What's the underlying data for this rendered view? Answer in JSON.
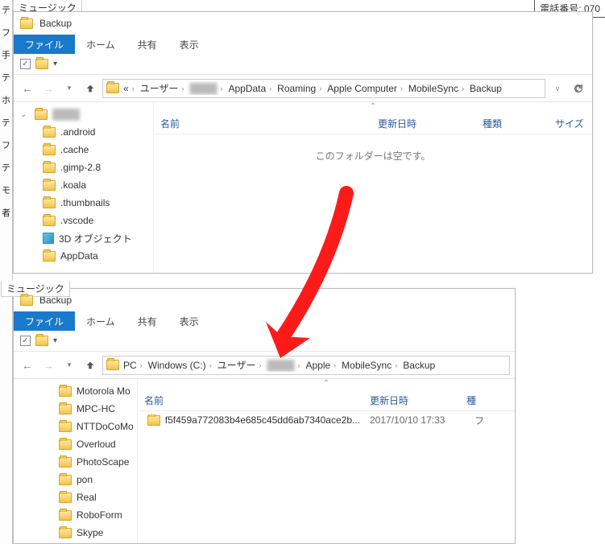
{
  "background": {
    "left_strip": [
      "テ",
      "フ",
      "手",
      "テ",
      "ホ",
      "テ",
      "フ",
      "テ",
      "モ",
      "者"
    ],
    "top_label": "ミュージック",
    "phone": "電話番号: 070"
  },
  "explorer1": {
    "title": "Backup",
    "tabs": {
      "file": "ファイル",
      "home": "ホーム",
      "share": "共有",
      "view": "表示"
    },
    "breadcrumb": [
      {
        "label": "«",
        "icon": false
      },
      {
        "label": "ユーザー"
      },
      {
        "label": "████",
        "blur": true
      },
      {
        "label": "AppData"
      },
      {
        "label": "Roaming"
      },
      {
        "label": "Apple Computer"
      },
      {
        "label": "MobileSync"
      },
      {
        "label": "Backup"
      }
    ],
    "tree": [
      {
        "label": "████",
        "blur": true,
        "expanded": true,
        "root": true
      },
      {
        "label": ".android"
      },
      {
        "label": ".cache"
      },
      {
        "label": ".gimp-2.8"
      },
      {
        "label": ".koala"
      },
      {
        "label": ".thumbnails"
      },
      {
        "label": ".vscode"
      },
      {
        "label": "3D オブジェクト",
        "icon": "cube"
      },
      {
        "label": "AppData"
      }
    ],
    "columns": {
      "name": "名前",
      "date": "更新日時",
      "type": "種類",
      "size": "サイズ"
    },
    "empty": "このフォルダーは空です。"
  },
  "explorer2": {
    "title": "Backup",
    "tabs": {
      "file": "ファイル",
      "home": "ホーム",
      "share": "共有",
      "view": "表示"
    },
    "background_label": "ミュージック",
    "breadcrumb": [
      {
        "label": "PC"
      },
      {
        "label": "Windows (C:)"
      },
      {
        "label": "ユーザー"
      },
      {
        "label": "████",
        "blur": true
      },
      {
        "label": "Apple"
      },
      {
        "label": "MobileSync"
      },
      {
        "label": "Backup"
      }
    ],
    "tree": [
      {
        "label": "Motorola Mo"
      },
      {
        "label": "MPC-HC"
      },
      {
        "label": "NTTDoCoMo"
      },
      {
        "label": "Overloud"
      },
      {
        "label": "PhotoScape"
      },
      {
        "label": "pon"
      },
      {
        "label": "Real"
      },
      {
        "label": "RoboForm"
      },
      {
        "label": "Skype"
      }
    ],
    "columns": {
      "name": "名前",
      "date": "更新日時",
      "type": "種"
    },
    "rows": [
      {
        "name": "f5f459a772083b4e685c45dd6ab7340ace2b...",
        "date": "2017/10/10 17:33",
        "type": "フ"
      }
    ]
  }
}
